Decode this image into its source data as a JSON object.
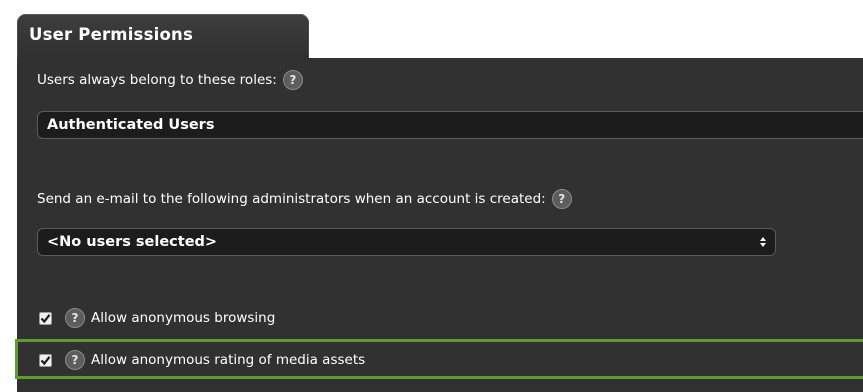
{
  "section": {
    "title": "User Permissions"
  },
  "roles": {
    "label": "Users always belong to these roles:",
    "value": "Authenticated Users"
  },
  "admins": {
    "label": "Send an e-mail to the following administrators when an account is created:",
    "selected": "<No users selected>"
  },
  "options": [
    {
      "label": "Allow anonymous browsing",
      "checked": true
    },
    {
      "label": "Allow anonymous rating of media assets",
      "checked": true
    }
  ],
  "help": {
    "glyph": "?"
  },
  "colors": {
    "panel_bg": "#313131",
    "tab_bg": "#3a3a3a",
    "highlight_border": "#5e9b33",
    "field_bg": "#1c1c1c"
  }
}
